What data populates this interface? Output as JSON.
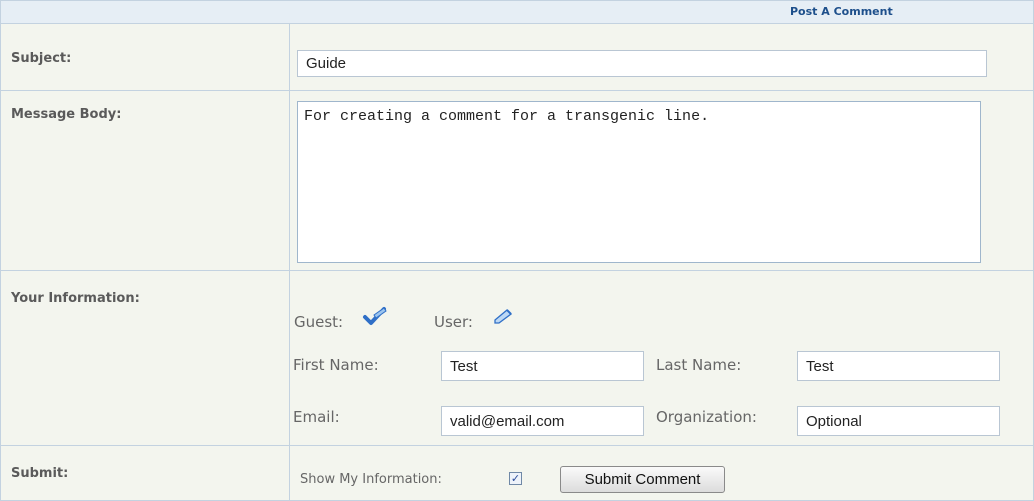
{
  "header": {
    "title": "Post A Comment"
  },
  "rows": {
    "subject": {
      "label": "Subject:",
      "value": "Guide"
    },
    "message": {
      "label": "Message Body:",
      "value": "For creating a comment for a transgenic line."
    },
    "info": {
      "label": "Your Information:",
      "guest_label": "Guest:",
      "user_label": "User:",
      "guest_icon": "checkmark-pen-icon",
      "user_icon": "pencil-icon",
      "first_name_label": "First Name:",
      "first_name_value": "Test",
      "last_name_label": "Last Name:",
      "last_name_value": "Test",
      "email_label": "Email:",
      "email_value": "valid@email.com",
      "organization_label": "Organization:",
      "organization_value": "Optional"
    },
    "submit": {
      "label": "Submit:",
      "show_info_label": "Show My Information:",
      "show_info_checked": true,
      "button_label": "Submit Comment"
    }
  },
  "colors": {
    "header_bg": "#e6eef5",
    "body_bg": "#f3f5ee",
    "border": "#c3d2e0",
    "title": "#1d4f8b"
  }
}
